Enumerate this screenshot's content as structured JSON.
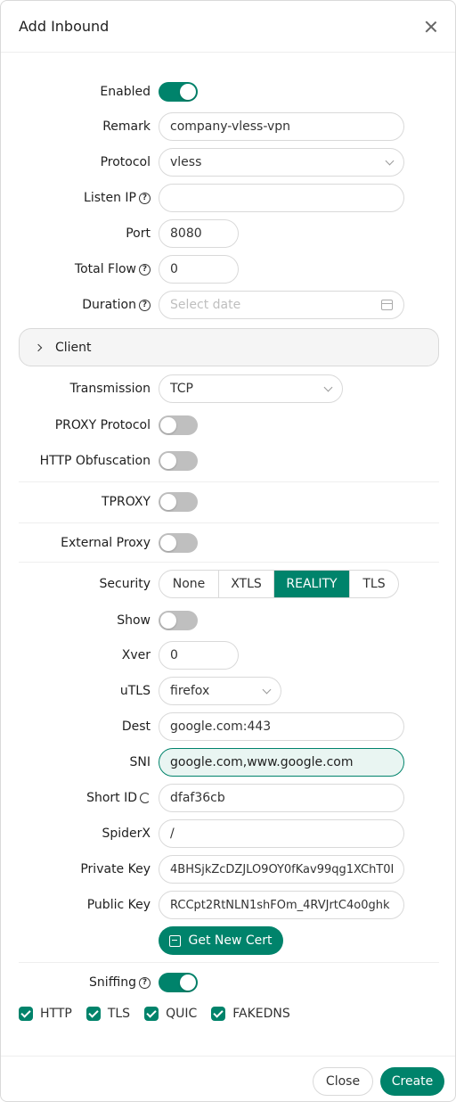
{
  "dialog": {
    "title": "Add Inbound"
  },
  "form": {
    "enabled": {
      "label": "Enabled",
      "on": true
    },
    "remark": {
      "label": "Remark",
      "value": "company-vless-vpn"
    },
    "protocol": {
      "label": "Protocol",
      "value": "vless"
    },
    "listen_ip": {
      "label": "Listen IP",
      "value": ""
    },
    "port": {
      "label": "Port",
      "value": "8080"
    },
    "total_flow": {
      "label": "Total Flow",
      "value": "0"
    },
    "duration": {
      "label": "Duration",
      "placeholder": "Select date"
    },
    "client": {
      "label": "Client"
    },
    "transmission": {
      "label": "Transmission",
      "value": "TCP"
    },
    "proxy_protocol": {
      "label": "PROXY Protocol",
      "on": false
    },
    "http_obfuscation": {
      "label": "HTTP Obfuscation",
      "on": false
    },
    "tproxy": {
      "label": "TPROXY",
      "on": false
    },
    "external_proxy": {
      "label": "External Proxy",
      "on": false
    },
    "security": {
      "label": "Security",
      "options": [
        "None",
        "XTLS",
        "REALITY",
        "TLS"
      ],
      "selected": "REALITY"
    },
    "show": {
      "label": "Show",
      "on": false
    },
    "xver": {
      "label": "Xver",
      "value": "0"
    },
    "utls": {
      "label": "uTLS",
      "value": "firefox"
    },
    "dest": {
      "label": "Dest",
      "value": "google.com:443"
    },
    "sni": {
      "label": "SNI",
      "value": "google.com,www.google.com"
    },
    "short_id": {
      "label": "Short ID",
      "value": "dfaf36cb"
    },
    "spiderx": {
      "label": "SpiderX",
      "value": "/"
    },
    "private_key": {
      "label": "Private Key",
      "value": "4BHSjkZcDZJLO9OY0fKav99qg1XChT0I"
    },
    "public_key": {
      "label": "Public Key",
      "value": "RCCpt2RtNLN1shFOm_4RVJrtC4o0ghk"
    },
    "get_new_cert": {
      "label": "Get New Cert"
    },
    "sniffing": {
      "label": "Sniffing",
      "on": true
    },
    "sniff_options": [
      "HTTP",
      "TLS",
      "QUIC",
      "FAKEDNS"
    ]
  },
  "footer": {
    "close_label": "Close",
    "create_label": "Create"
  },
  "colors": {
    "accent": "#00836b",
    "toggle_off": "#bfbfbf",
    "border": "#d9d9d9"
  },
  "icons": {
    "close": "close-icon",
    "help": "question-circle-icon",
    "calendar": "calendar-icon",
    "refresh": "refresh-icon",
    "cert": "cert-icon",
    "chevron": "chevron-down-icon",
    "expand": "chevron-right-icon"
  }
}
